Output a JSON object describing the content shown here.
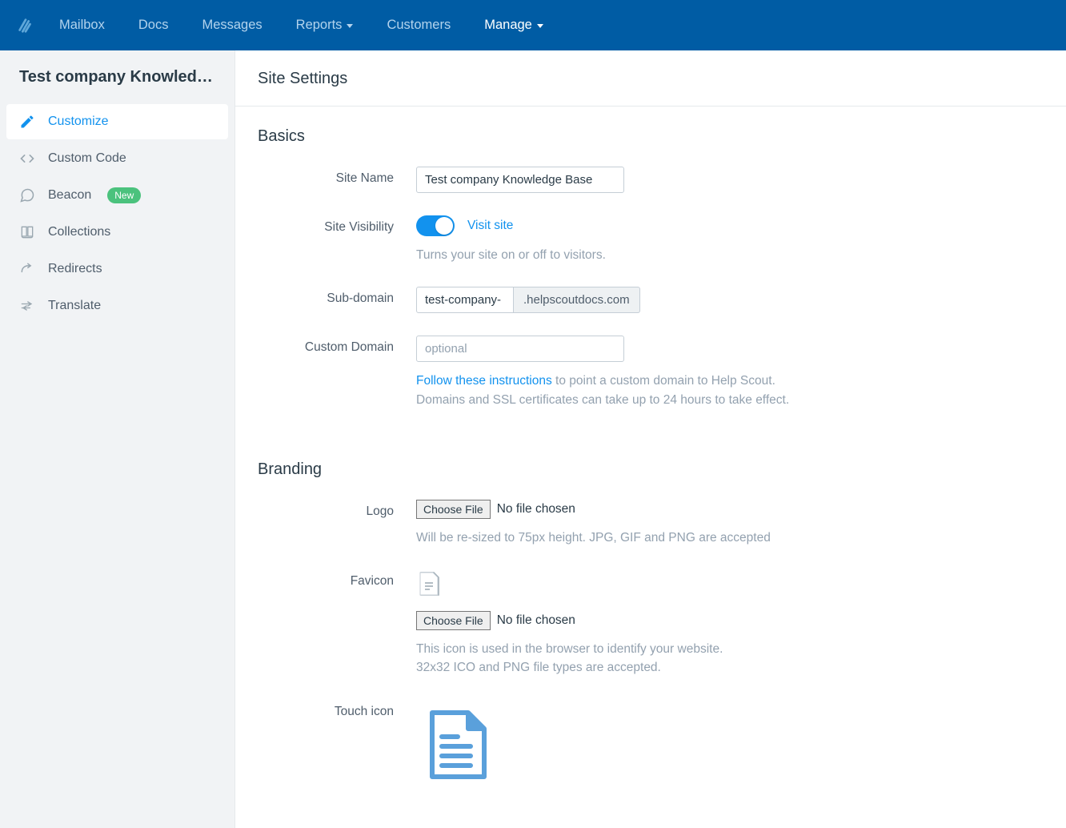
{
  "nav": {
    "items": [
      {
        "label": "Mailbox"
      },
      {
        "label": "Docs"
      },
      {
        "label": "Messages"
      },
      {
        "label": "Reports"
      },
      {
        "label": "Customers"
      },
      {
        "label": "Manage"
      }
    ]
  },
  "sidebar": {
    "title": "Test company Knowled…",
    "items": [
      {
        "label": "Customize"
      },
      {
        "label": "Custom Code"
      },
      {
        "label": "Beacon",
        "badge": "New"
      },
      {
        "label": "Collections"
      },
      {
        "label": "Redirects"
      },
      {
        "label": "Translate"
      }
    ]
  },
  "page_title": "Site Settings",
  "basics": {
    "heading": "Basics",
    "site_name_label": "Site Name",
    "site_name_value": "Test company Knowledge Base",
    "visibility_label": "Site Visibility",
    "visit_link": "Visit site",
    "visibility_help": "Turns your site on or off to visitors.",
    "subdomain_label": "Sub-domain",
    "subdomain_value": "test-company-",
    "subdomain_suffix": ".helpscoutdocs.com",
    "custom_domain_label": "Custom Domain",
    "custom_domain_placeholder": "optional",
    "custom_domain_link": "Follow these instructions",
    "custom_domain_help1": " to point a custom domain to Help Scout.",
    "custom_domain_help2": "Domains and SSL certificates can take up to 24 hours to take effect."
  },
  "branding": {
    "heading": "Branding",
    "logo_label": "Logo",
    "choose_file": "Choose File",
    "no_file": "No file chosen",
    "logo_help": "Will be re-sized to 75px height. JPG, GIF and PNG are accepted",
    "favicon_label": "Favicon",
    "favicon_help1": "This icon is used in the browser to identify your website.",
    "favicon_help2": "32x32 ICO and PNG file types are accepted.",
    "touch_label": "Touch icon"
  }
}
